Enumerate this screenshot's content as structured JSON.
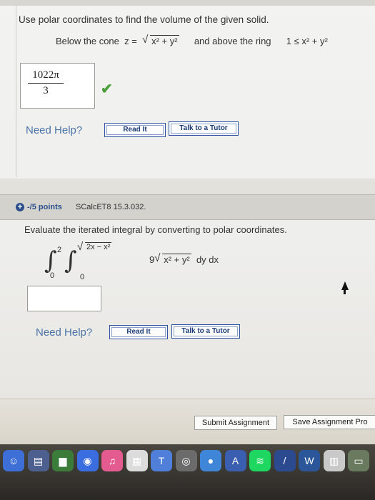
{
  "question1": {
    "instruction": "Use polar coordinates to find the volume of the given solid.",
    "below_text": "Below the cone",
    "z_eq": "z =",
    "radicand": "x² + y²",
    "above_text": "and above the ring",
    "ring_expr": "1 ≤ x² + y²",
    "answer": {
      "numerator": "1022π",
      "denominator": "3"
    },
    "need_help": "Need Help?",
    "read_it": "Read It",
    "talk_tutor": "Talk to a Tutor"
  },
  "question2": {
    "points": "-/5 points",
    "course_code": "SCalcET8 15.3.032.",
    "instruction": "Evaluate the iterated integral by converting to polar coordinates.",
    "outer_upper": "2",
    "outer_lower": "0",
    "inner_upper": "2x − x²",
    "inner_lower": "0",
    "coefficient": "9",
    "integrand_radicand": "x² + y²",
    "differentials": "dy dx",
    "answer_value": "",
    "need_help": "Need Help?",
    "read_it": "Read It",
    "talk_tutor": "Talk to a Tutor"
  },
  "footer": {
    "submit": "Submit Assignment",
    "save": "Save Assignment Pro"
  },
  "colors": {
    "link_blue": "#4c73a8",
    "check_green": "#4a9f3a",
    "button_border": "#2d53a0"
  },
  "dock": {
    "icons": [
      {
        "name": "finder-icon",
        "color": "#3d6fd6",
        "glyph": "☺"
      },
      {
        "name": "files-icon",
        "color": "#4d5f8f",
        "glyph": "▤"
      },
      {
        "name": "chart-app-icon",
        "color": "#3b7c3b",
        "glyph": "▆"
      },
      {
        "name": "app-store-icon",
        "color": "#3a6ee0",
        "glyph": "◉"
      },
      {
        "name": "itunes-icon",
        "color": "#e35b8f",
        "glyph": "♫"
      },
      {
        "name": "notes-icon",
        "color": "#dcdcdc",
        "glyph": "▦"
      },
      {
        "name": "keynote-icon",
        "color": "#4f7fd8",
        "glyph": "T"
      },
      {
        "name": "camera-icon",
        "color": "#6b6b6b",
        "glyph": "◎"
      },
      {
        "name": "facetime-icon",
        "color": "#3f86d9",
        "glyph": "●"
      },
      {
        "name": "triangle-app-icon",
        "color": "#3a5fb0",
        "glyph": "A"
      },
      {
        "name": "spotify-icon",
        "color": "#1ed760",
        "glyph": "≋"
      },
      {
        "name": "terminal-icon",
        "color": "#2b4a8f",
        "glyph": "/"
      },
      {
        "name": "word-icon",
        "color": "#2b579a",
        "glyph": "W"
      },
      {
        "name": "docs-icon",
        "color": "#c9c9c9",
        "glyph": "▥"
      },
      {
        "name": "folder-icon",
        "color": "#6a7a5e",
        "glyph": "▭"
      }
    ]
  }
}
